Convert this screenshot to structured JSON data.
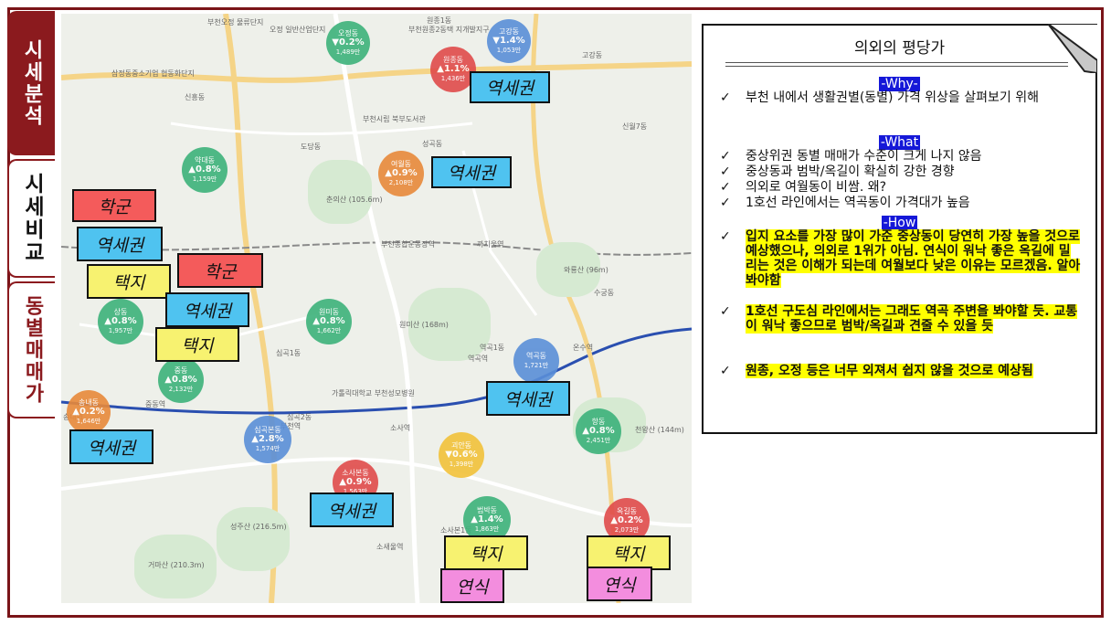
{
  "tabs": [
    {
      "label": "시세분석"
    },
    {
      "label": "시세비교"
    },
    {
      "label": "동별매매가"
    }
  ],
  "map": {
    "labels": [
      "부천오정 물류단지",
      "오정 일반산업단지",
      "삼정동중소기업 협동화단지",
      "원종1동",
      "부천원종2동택 지개발지구",
      "고강동",
      "신흥동",
      "부천시립 북부도서관",
      "도당동",
      "성곡동",
      "신월7동",
      "춘의산 (105.6m)",
      "부천종합운동장역",
      "까치울역",
      "원미산 (168m)",
      "수궁동",
      "와룡산 (96m)",
      "역곡1동",
      "역곡역",
      "온수역",
      "심곡1동",
      "심곡2동",
      "부천역",
      "소사역",
      "소사본1동",
      "성주산 (216.5m)",
      "거마산 (210.3m)",
      "소새울역",
      "가톨릭대학교 부천성모병원",
      "중동역",
      "송내역",
      "천왕산 (144m)"
    ],
    "pins": [
      {
        "dong": "오정동",
        "change": "▼0.2%",
        "price": "1,489만",
        "color": "g"
      },
      {
        "dong": "고강동",
        "change": "▼1.4%",
        "price": "1,053만",
        "color": "b"
      },
      {
        "dong": "원종동",
        "change": "▲1.1%",
        "price": "1,436만",
        "color": "r"
      },
      {
        "dong": "약대동",
        "change": "▲0.8%",
        "price": "1,159만",
        "color": "g"
      },
      {
        "dong": "여월동",
        "change": "▲0.9%",
        "price": "2,108만",
        "color": "o"
      },
      {
        "dong": "원미동",
        "change": "▲0.8%",
        "price": "1,662만",
        "color": "g"
      },
      {
        "dong": "상동",
        "change": "▲0.8%",
        "price": "1,957만",
        "color": "g"
      },
      {
        "dong": "중동",
        "change": "▲0.8%",
        "price": "2,132만",
        "color": "g"
      },
      {
        "dong": "송내동",
        "change": "▲0.2%",
        "price": "1,646만",
        "color": "o"
      },
      {
        "dong": "심곡본동",
        "change": "▲2.8%",
        "price": "1,574만",
        "color": "b"
      },
      {
        "dong": "역곡동",
        "change": "",
        "price": "1,721만",
        "color": "b"
      },
      {
        "dong": "괴안동",
        "change": "▼0.6%",
        "price": "1,398만",
        "color": "y"
      },
      {
        "dong": "항동",
        "change": "▲0.8%",
        "price": "2,451만",
        "color": "g"
      },
      {
        "dong": "소사본동",
        "change": "▲0.9%",
        "price": "1,563만",
        "color": "r"
      },
      {
        "dong": "범박동",
        "change": "▲1.4%",
        "price": "1,863만",
        "color": "g"
      },
      {
        "dong": "옥길동",
        "change": "▲0.2%",
        "price": "2,073만",
        "color": "r"
      }
    ],
    "tags": [
      {
        "text": "역세권",
        "kind": "blue"
      },
      {
        "text": "역세권",
        "kind": "blue"
      },
      {
        "text": "학군",
        "kind": "red"
      },
      {
        "text": "역세권",
        "kind": "blue"
      },
      {
        "text": "택지",
        "kind": "yellow"
      },
      {
        "text": "학군",
        "kind": "red"
      },
      {
        "text": "역세권",
        "kind": "blue"
      },
      {
        "text": "택지",
        "kind": "yellow"
      },
      {
        "text": "역세권",
        "kind": "blue"
      },
      {
        "text": "역세권",
        "kind": "blue"
      },
      {
        "text": "역세권",
        "kind": "blue"
      },
      {
        "text": "택지",
        "kind": "yellow"
      },
      {
        "text": "택지",
        "kind": "yellow"
      },
      {
        "text": "연식",
        "kind": "pink"
      },
      {
        "text": "연식",
        "kind": "pink"
      }
    ]
  },
  "panel": {
    "title": "의외의 평당가",
    "why": "-Why-",
    "why_items": [
      "부천 내에서 생활권별(동별) 가격 위상을 살펴보기 위해"
    ],
    "what": "-What",
    "what_items": [
      "중상위권 동별 매매가 수준이 크게 나지 않음",
      "중상동과 범박/옥길이 확실히 강한 경향",
      "의외로 여월동이 비쌈. 왜?",
      "1호선 라인에서는 역곡동이 가격대가 높음"
    ],
    "how": "-How",
    "how_items": [
      "입지 요소를 가장 많이 가준 중상동이 당연히 가장 높을 것으로 예상했으나, 의외로 1위가 아님. 연식이 워낙 좋은 옥길에 밀리는 것은 이해가 되는데 여월보다 낮은 이유는 모르겠음. 알아봐야함",
      "1호선 구도심 라인에서는 그래도 역곡 주변을 봐야할 듯. 교통이 워낙 좋으므로 범박/옥길과 견줄 수 있을 듯",
      "원종, 오정 등은 너무 외져서 쉽지 않을 것으로 예상됨"
    ],
    "check": "✓"
  },
  "colors": {
    "accent": "#8b1a1e",
    "section_bg": "#1518d8",
    "highlight": "#ffff00"
  }
}
